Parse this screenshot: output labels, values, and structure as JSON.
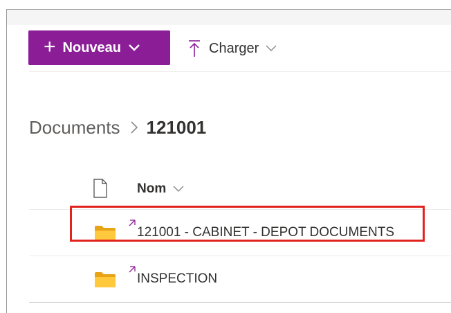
{
  "toolbar": {
    "new_label": "Nouveau",
    "new_icon": "plus-icon",
    "new_button_color": "#8b1e97",
    "upload_label": "Charger",
    "upload_icon": "upload-icon"
  },
  "breadcrumb": {
    "root": "Documents",
    "current": "121001"
  },
  "list": {
    "header": {
      "file_type_icon": "document-icon",
      "name_column": "Nom"
    },
    "rows": [
      {
        "name": "121001 - CABINET - DEPOT DOCUMENTS",
        "icon": "folder-icon",
        "new_indicator": true,
        "highlighted": true
      },
      {
        "name": "INSPECTION",
        "icon": "folder-icon",
        "new_indicator": true,
        "highlighted": false
      }
    ]
  },
  "annotation": {
    "highlight_color": "#e0231d"
  }
}
